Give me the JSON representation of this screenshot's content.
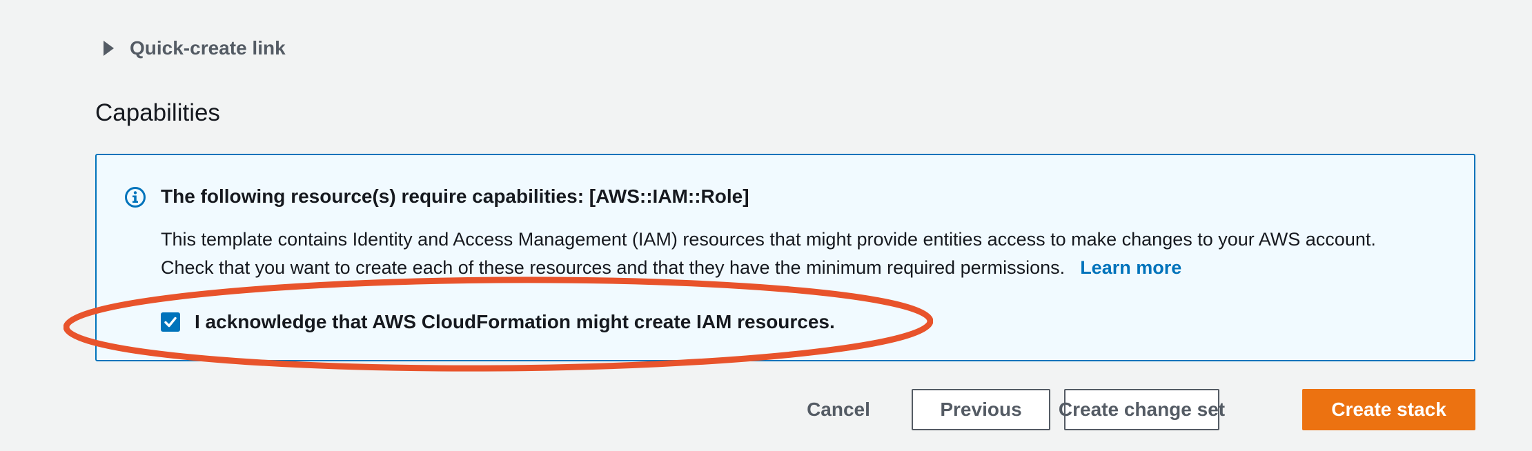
{
  "quick_create": {
    "label": "Quick-create link",
    "icon": "caret-right-icon"
  },
  "capabilities": {
    "title": "Capabilities",
    "alert": {
      "icon": "info-icon",
      "header": "The following resource(s) require capabilities: [AWS::IAM::Role]",
      "body_line1": "This template contains Identity and Access Management (IAM) resources that might provide entities access to make changes to your AWS account.",
      "body_line2": "Check that you want to create each of these resources and that they have the minimum required permissions.",
      "learn_more": "Learn more"
    },
    "acknowledge": {
      "label": "I acknowledge that AWS CloudFormation might create IAM resources.",
      "checked": true
    }
  },
  "footer": {
    "cancel": "Cancel",
    "previous": "Previous",
    "create_change_set": "Create change set",
    "create_stack": "Create stack"
  },
  "colors": {
    "background": "#f2f3f3",
    "accent": "#0073bb",
    "primary_button": "#ec7211",
    "annotation": "#e8532b"
  }
}
